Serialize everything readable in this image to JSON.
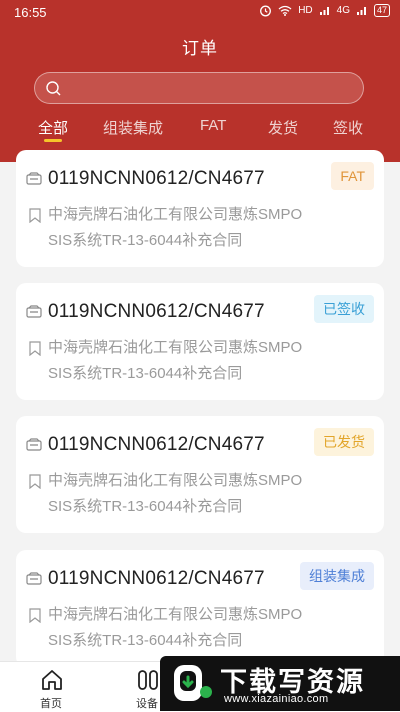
{
  "status_bar": {
    "time": "16:55",
    "network": "HD",
    "signal": "4G",
    "battery": "47"
  },
  "header": {
    "title": "订单"
  },
  "search": {
    "value": "",
    "placeholder": ""
  },
  "tabs": [
    {
      "label": "全部",
      "active": true
    },
    {
      "label": "组装集成",
      "active": false
    },
    {
      "label": "FAT",
      "active": false
    },
    {
      "label": "发货",
      "active": false
    },
    {
      "label": "签收",
      "active": false
    }
  ],
  "orders": [
    {
      "order_no": "0119NCNN0612/CN4677",
      "status": "FAT",
      "contract_line1": "中海壳牌石油化工有限公司惠炼SMPO",
      "contract_line2": "SIS系统TR-13-6044补充合同"
    },
    {
      "order_no": "0119NCNN0612/CN4677",
      "status": "已签收",
      "contract_line1": "中海壳牌石油化工有限公司惠炼SMPO",
      "contract_line2": "SIS系统TR-13-6044补充合同"
    },
    {
      "order_no": "0119NCNN0612/CN4677",
      "status": "已发货",
      "contract_line1": "中海壳牌石油化工有限公司惠炼SMPO",
      "contract_line2": "SIS系统TR-13-6044补充合同"
    },
    {
      "order_no": "0119NCNN0612/CN4677",
      "status": "组装集成",
      "contract_line1": "中海壳牌石油化工有限公司惠炼SMPO",
      "contract_line2": "SIS系统TR-13-6044补充合同"
    }
  ],
  "status_colors": {
    "FAT": {
      "bg": "#fdf0e1",
      "fg": "#e0953a"
    },
    "已签收": {
      "bg": "#e3f4fb",
      "fg": "#3aa0d6"
    },
    "已发货": {
      "bg": "#fdf3dc",
      "fg": "#e2a52a"
    },
    "组装集成": {
      "bg": "#e8eefb",
      "fg": "#4e7fd6"
    }
  },
  "bottom_nav": [
    {
      "label": "首页",
      "icon": "home-icon"
    },
    {
      "label": "设备",
      "icon": "device-icon"
    }
  ],
  "watermark": {
    "title": "下载写资源",
    "url": "www.xiazainiao.com"
  },
  "colors": {
    "brand": "#b8322b",
    "tab_indicator": "#f6c52a"
  }
}
